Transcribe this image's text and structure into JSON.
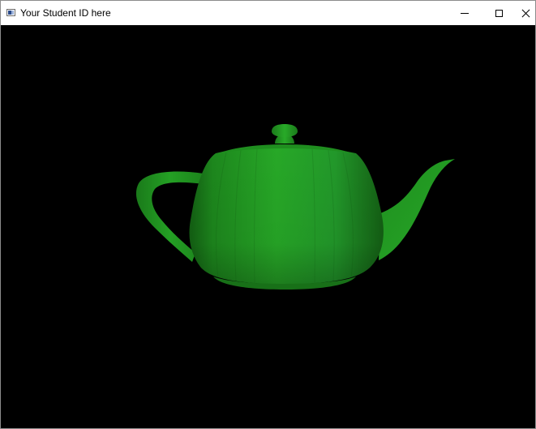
{
  "window": {
    "title": "Your Student ID here",
    "controls": {
      "minimize_icon": "minimize-icon",
      "maximize_icon": "maximize-icon",
      "close_icon": "close-icon"
    }
  },
  "scene": {
    "background_color": "#000000",
    "object": "teapot",
    "object_color": "#22a022"
  }
}
